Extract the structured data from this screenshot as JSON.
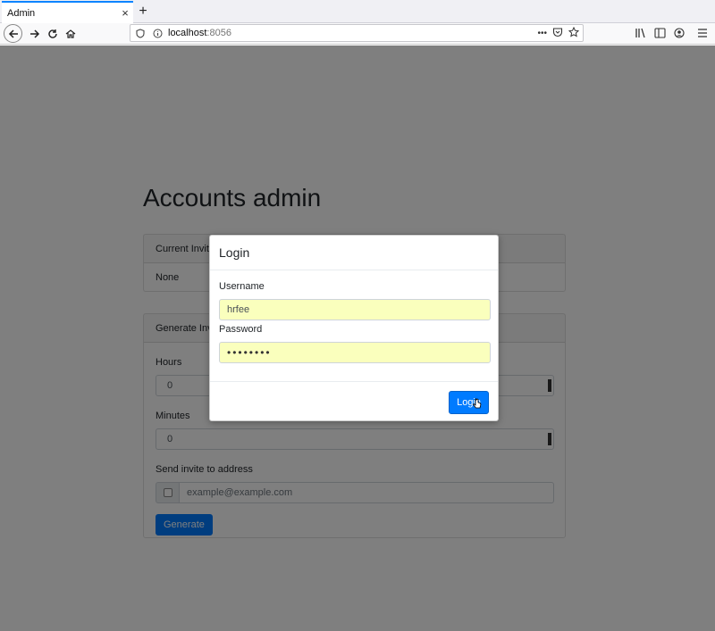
{
  "browser": {
    "tab_title": "Admin",
    "tab_close": "×",
    "new_tab": "+",
    "url_host": "localhost",
    "url_port": ":8056",
    "url_dots": "•••"
  },
  "page": {
    "title": "Accounts admin",
    "current_invites": {
      "header": "Current Invites",
      "value": "None"
    },
    "generate_invite": {
      "header": "Generate Invite",
      "hours_label": "Hours",
      "hours_value": "0",
      "minutes_label": "Minutes",
      "minutes_value": "0",
      "send_label": "Send invite to address",
      "email_placeholder": "example@example.com",
      "generate_button": "Generate"
    }
  },
  "modal": {
    "title": "Login",
    "username_label": "Username",
    "username_value": "hrfee",
    "password_label": "Password",
    "password_value": "••••••••",
    "login_button": "Login"
  },
  "colors": {
    "primary": "#007bff",
    "autofill": "#faffbd",
    "tab_accent": "#0a84ff"
  }
}
